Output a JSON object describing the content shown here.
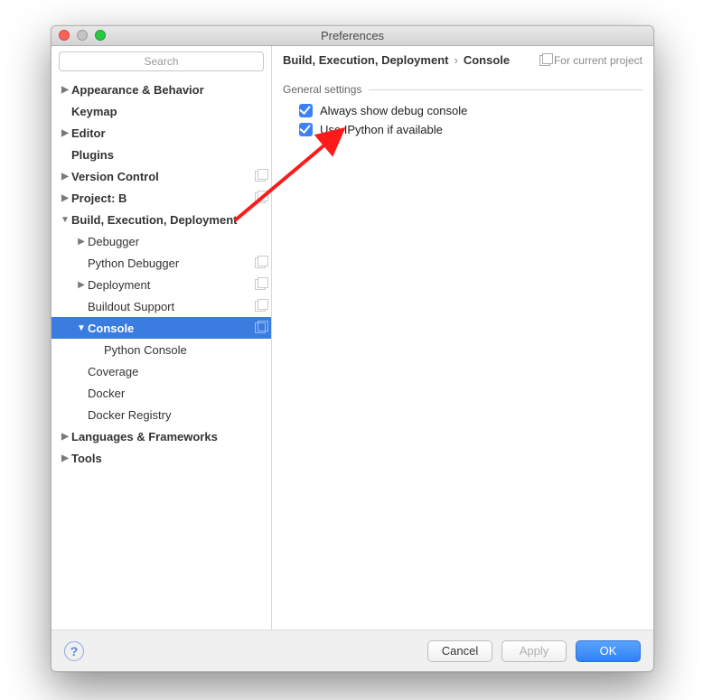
{
  "window": {
    "title": "Preferences"
  },
  "search": {
    "placeholder": "Search"
  },
  "sidebar": {
    "items": [
      {
        "label": "Appearance & Behavior",
        "bold": true,
        "level": 0,
        "arrow": "right"
      },
      {
        "label": "Keymap",
        "bold": true,
        "level": 0
      },
      {
        "label": "Editor",
        "bold": true,
        "level": 0,
        "arrow": "right"
      },
      {
        "label": "Plugins",
        "bold": true,
        "level": 0
      },
      {
        "label": "Version Control",
        "bold": true,
        "level": 0,
        "arrow": "right",
        "copy": true
      },
      {
        "label": "Project: B",
        "bold": true,
        "level": 0,
        "arrow": "right",
        "copy": true
      },
      {
        "label": "Build, Execution, Deployment",
        "bold": true,
        "level": 0,
        "arrow": "down"
      },
      {
        "label": "Debugger",
        "level": 1,
        "arrow": "right"
      },
      {
        "label": "Python Debugger",
        "level": 1,
        "copy": true
      },
      {
        "label": "Deployment",
        "level": 1,
        "arrow": "right",
        "copy": true
      },
      {
        "label": "Buildout Support",
        "level": 1,
        "copy": true
      },
      {
        "label": "Console",
        "bold": true,
        "level": 1,
        "arrow": "down",
        "copy": true,
        "selected": true
      },
      {
        "label": "Python Console",
        "level": 2
      },
      {
        "label": "Coverage",
        "level": 1
      },
      {
        "label": "Docker",
        "level": 1
      },
      {
        "label": "Docker Registry",
        "level": 1
      },
      {
        "label": "Languages & Frameworks",
        "bold": true,
        "level": 0,
        "arrow": "right"
      },
      {
        "label": "Tools",
        "bold": true,
        "level": 0,
        "arrow": "right"
      }
    ]
  },
  "breadcrumb": {
    "parent": "Build, Execution, Deployment",
    "child": "Console",
    "project_badge": "For current project"
  },
  "settings": {
    "section_title": "General settings",
    "options": [
      {
        "label": "Always show debug console",
        "checked": true,
        "highlight": true
      },
      {
        "label": "Use IPython if available",
        "checked": true
      }
    ]
  },
  "footer": {
    "cancel": "Cancel",
    "apply": "Apply",
    "ok": "OK"
  }
}
